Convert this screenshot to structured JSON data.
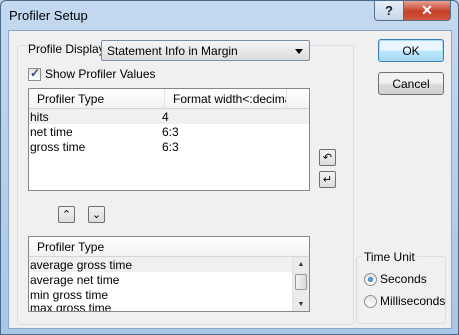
{
  "window": {
    "title": "Profiler Setup",
    "help_label": "?",
    "close_label": "✕"
  },
  "profile_display": {
    "label": "Profile Display",
    "selected": "Statement Info in Margin"
  },
  "show_values": {
    "label": "Show Profiler Values",
    "checked": true
  },
  "active_list": {
    "headers": [
      "Profiler Type",
      "Format width<:decimals>"
    ],
    "rows": [
      {
        "type": "hits",
        "format": "4"
      },
      {
        "type": "net time",
        "format": "6:3"
      },
      {
        "type": "gross time",
        "format": "6:3"
      }
    ]
  },
  "available_list": {
    "header": "Profiler Type",
    "rows": [
      "average gross time",
      "average net time",
      "min gross time",
      "max gross time"
    ]
  },
  "buttons": {
    "ok": "OK",
    "cancel": "Cancel",
    "move_up_icon": "⌃",
    "move_down_icon": "⌄",
    "rotate_up_icon": "↶",
    "rotate_down_icon": "↵"
  },
  "time_unit": {
    "label": "Time Unit",
    "options": [
      "Seconds",
      "Milliseconds"
    ],
    "selected": "Seconds"
  }
}
